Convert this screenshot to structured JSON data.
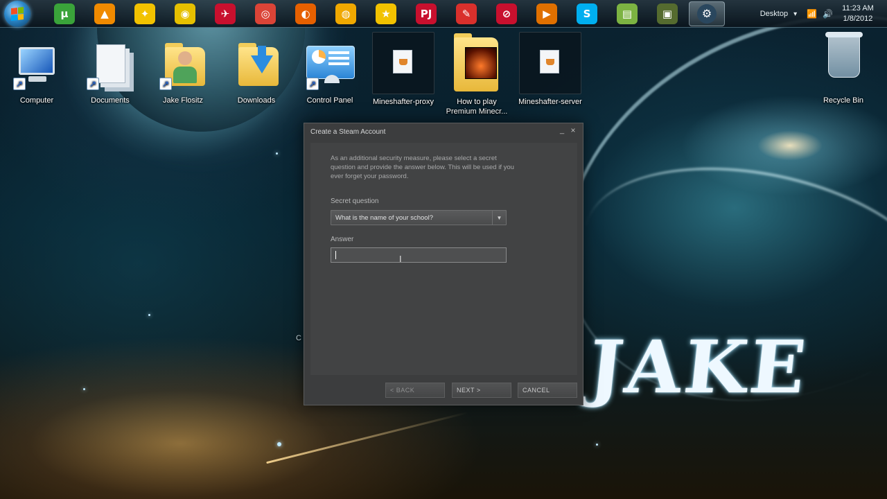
{
  "taskbar": {
    "start_label": "Start",
    "apps": [
      {
        "name": "utorrent-icon",
        "glyph": "µ",
        "color": "#3aa33a"
      },
      {
        "name": "vlc-icon",
        "glyph": "▲",
        "color": "#f08a00"
      },
      {
        "name": "puzzle-app-icon",
        "glyph": "✦",
        "color": "#f2c200"
      },
      {
        "name": "disc-app-icon",
        "glyph": "◉",
        "color": "#e6c000"
      },
      {
        "name": "red-app-icon",
        "glyph": "✈",
        "color": "#c8102e"
      },
      {
        "name": "chrome-icon",
        "glyph": "◎",
        "color": "#db4437"
      },
      {
        "name": "firefox-icon",
        "glyph": "◐",
        "color": "#e66000"
      },
      {
        "name": "webcam-icon",
        "glyph": "◍",
        "color": "#f0a800"
      },
      {
        "name": "aim-icon",
        "glyph": "★",
        "color": "#f2c200"
      },
      {
        "name": "pj64-icon",
        "glyph": "PJ",
        "color": "#c8102e"
      },
      {
        "name": "pencil-app-icon",
        "glyph": "✎",
        "color": "#d9302c"
      },
      {
        "name": "no-entry-app-icon",
        "glyph": "⊘",
        "color": "#c8102e"
      },
      {
        "name": "media-player-icon",
        "glyph": "▶",
        "color": "#e07000"
      },
      {
        "name": "skype-icon",
        "glyph": "S",
        "color": "#00aff0"
      },
      {
        "name": "note-app-icon",
        "glyph": "▤",
        "color": "#7cb342"
      },
      {
        "name": "app-window-icon",
        "glyph": "▣",
        "color": "#556b2f"
      }
    ],
    "active_app": {
      "name": "steam-icon",
      "glyph": "⚙",
      "color": "#1b2838"
    },
    "tray": {
      "desktop_label": "Desktop",
      "expand_glyph": "▾",
      "signal_glyph": "📶",
      "volume_glyph": "🔊",
      "time": "11:23 AM",
      "date": "1/8/2012"
    }
  },
  "desktop": {
    "icons": [
      {
        "label": "Computer"
      },
      {
        "label": "Documents"
      },
      {
        "label": "Jake Flositz"
      },
      {
        "label": "Downloads"
      },
      {
        "label": "Control Panel"
      },
      {
        "label": "Mineshafter-proxy"
      },
      {
        "label": "How to play Premium Minecr..."
      },
      {
        "label": "Mineshafter-server"
      },
      {
        "label": "Recycle Bin"
      }
    ],
    "wallpaper_text": "JAKE",
    "partial_label": "C"
  },
  "dialog": {
    "title": "Create a Steam Account",
    "minimize_glyph": "_",
    "close_glyph": "×",
    "intro": "As an additional security measure, please select a secret question and provide the answer below. This will be used if you ever forget your password.",
    "secret_question_label": "Secret question",
    "secret_question_value": "What is the name of your school?",
    "dropdown_glyph": "▼",
    "answer_label": "Answer",
    "answer_value": "",
    "buttons": {
      "back": "< BACK",
      "next": "NEXT >",
      "cancel": "CANCEL"
    }
  }
}
